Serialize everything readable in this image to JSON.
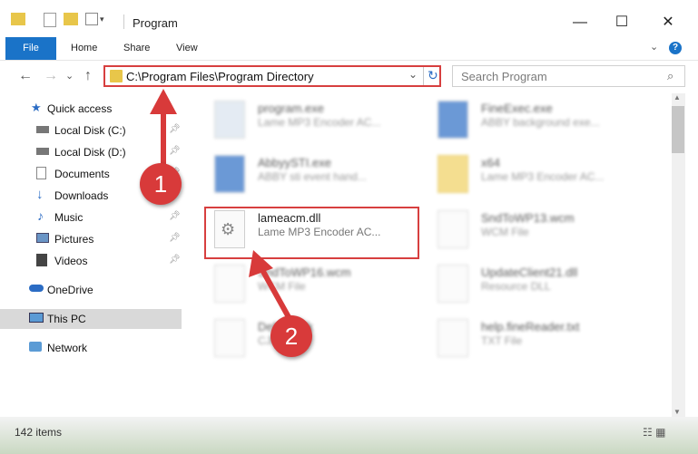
{
  "window": {
    "title": "Program",
    "minimize": "—",
    "maximize": "☐",
    "close": "✕"
  },
  "ribbon": {
    "tabs": [
      "File",
      "Home",
      "Share",
      "View"
    ]
  },
  "nav": {
    "back": "←",
    "forward": "→",
    "recent": "⌄",
    "up": "↑",
    "address": "C:\\Program Files\\Program Directory",
    "refresh": "↻",
    "search_placeholder": "Search Program"
  },
  "sidebar": {
    "items": [
      {
        "label": "Quick access",
        "icon": "star-icon",
        "pinned": false
      },
      {
        "label": "Local Disk (C:)",
        "icon": "drive-icon",
        "pinned": true
      },
      {
        "label": "Local Disk (D:)",
        "icon": "drive-icon",
        "pinned": true
      },
      {
        "label": "Documents",
        "icon": "documents-icon",
        "pinned": true
      },
      {
        "label": "Downloads",
        "icon": "download-icon",
        "pinned": true
      },
      {
        "label": "Music",
        "icon": "music-icon",
        "pinned": true
      },
      {
        "label": "Pictures",
        "icon": "pictures-icon",
        "pinned": true
      },
      {
        "label": "Videos",
        "icon": "videos-icon",
        "pinned": true
      },
      {
        "label": "OneDrive",
        "icon": "cloud-icon",
        "pinned": false
      },
      {
        "label": "This PC",
        "icon": "pc-icon",
        "pinned": false,
        "selected": true
      },
      {
        "label": "Network",
        "icon": "network-icon",
        "pinned": false
      }
    ]
  },
  "files": [
    {
      "name": "program.exe",
      "desc": "Lame MP3 Encoder AC..."
    },
    {
      "name": "FineExec.exe",
      "desc": "ABBY background exe..."
    },
    {
      "name": "AbbyySTI.exe",
      "desc": "ABBY sti event hand..."
    },
    {
      "name": "x64",
      "desc": "Lame MP3 Encoder AC..."
    },
    {
      "name": "lameacm.dll",
      "desc": "Lame MP3 Encoder AC..."
    },
    {
      "name": "SndToWP13.wcm",
      "desc": "WCM File"
    },
    {
      "name": "SndToWP16.wcm",
      "desc": "WCM File"
    },
    {
      "name": "UpdateClient21.dll",
      "desc": "Resource DLL"
    },
    {
      "name": "Default.cjk",
      "desc": "CJK File"
    },
    {
      "name": "help.fineReader.txt",
      "desc": "TXT File"
    }
  ],
  "status": {
    "count": "142 items"
  },
  "annotations": {
    "step1": "1",
    "step2": "2"
  },
  "colors": {
    "accent": "#1a73c8",
    "highlight": "#d73f3f"
  }
}
